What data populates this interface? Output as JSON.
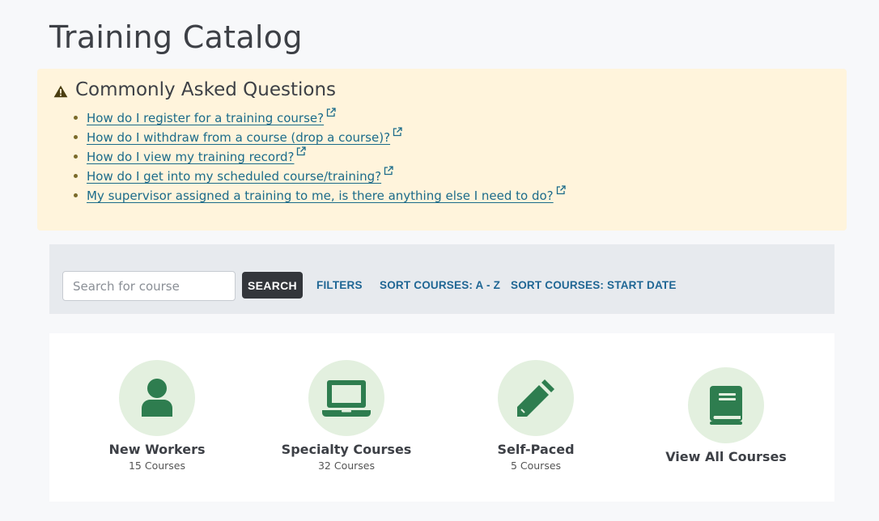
{
  "page": {
    "title": "Training Catalog"
  },
  "faq": {
    "heading": "Commonly Asked Questions",
    "items": [
      "How do I register for a training course?",
      "How do I withdraw from a course (drop a course)?",
      "How do I view my training record?",
      "How do I get into my scheduled course/training?",
      "My supervisor assigned a training to me, is there anything else I need to do?"
    ]
  },
  "toolbar": {
    "search_placeholder": "Search for course",
    "search_label": "SEARCH",
    "filters_label": "FILTERS",
    "sort_az_label": "SORT COURSES: A - Z",
    "sort_date_label": "SORT COURSES: START DATE"
  },
  "categories": [
    {
      "title": "New Workers",
      "count": "15 Courses",
      "icon": "user-icon"
    },
    {
      "title": "Specialty Courses",
      "count": "32 Courses",
      "icon": "laptop-icon"
    },
    {
      "title": "Self-Paced",
      "count": "5 Courses",
      "icon": "pencil-icon"
    },
    {
      "title": "View All Courses",
      "count": "",
      "icon": "book-icon"
    }
  ],
  "colors": {
    "faq_background": "#fff4dc",
    "link": "#1b6b8a",
    "icon_green": "#2e7d4f",
    "icon_circle": "#e3f0df",
    "search_button": "#33363b"
  }
}
